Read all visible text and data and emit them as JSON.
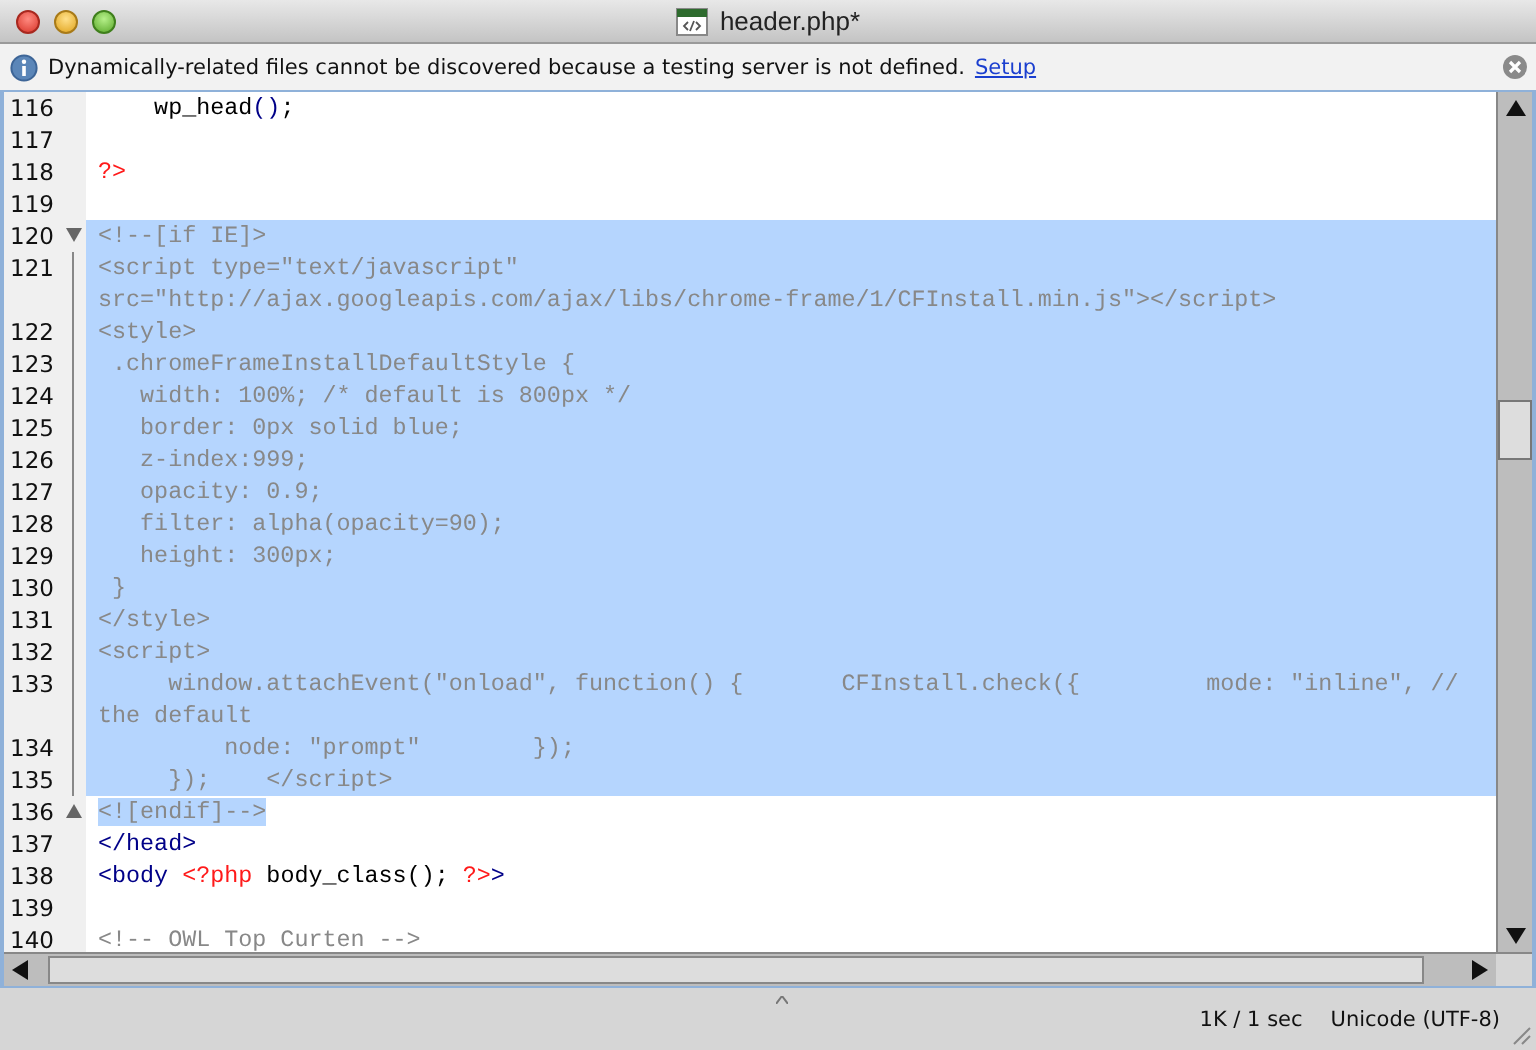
{
  "window": {
    "title": "header.php*"
  },
  "info_bar": {
    "message": "Dynamically-related files cannot be discovered because a testing server is not defined.",
    "link": "Setup"
  },
  "lines": [
    {
      "number": "116",
      "kind": "code",
      "selected": false,
      "segments": [
        {
          "kind": "plain",
          "text": "    wp_head"
        },
        {
          "kind": "tag",
          "text": "()"
        },
        {
          "kind": "plain",
          "text": ";"
        }
      ]
    },
    {
      "number": "117",
      "kind": "code",
      "selected": false
    },
    {
      "number": "118",
      "kind": "code",
      "selected": false,
      "segments": [
        {
          "kind": "php",
          "text": "?>"
        }
      ]
    },
    {
      "number": "119",
      "kind": "code",
      "selected": false
    },
    {
      "number": "120",
      "kind": "fold-start",
      "selected": true,
      "segments": [
        {
          "kind": "comment",
          "text": "<!--[if IE]>"
        }
      ]
    },
    {
      "number": "121",
      "kind": "code",
      "selected": true,
      "segments": [
        {
          "kind": "comment",
          "text": "<script type=\"text/javascript\""
        }
      ]
    },
    {
      "kind": "code",
      "selected": true,
      "segments": [
        {
          "kind": "comment",
          "text": "src=\"http://ajax.googleapis.com/ajax/libs/chrome-frame/1/CFInstall.min.js\"></script>"
        }
      ]
    },
    {
      "number": "122",
      "kind": "code",
      "selected": true,
      "segments": [
        {
          "kind": "comment",
          "text": "<style>"
        }
      ]
    },
    {
      "number": "123",
      "kind": "code",
      "selected": true,
      "segments": [
        {
          "kind": "comment",
          "text": " .chromeFrameInstallDefaultStyle {"
        }
      ]
    },
    {
      "number": "124",
      "kind": "code",
      "selected": true,
      "segments": [
        {
          "kind": "comment",
          "text": "   width: 100%; /* default is 800px */"
        }
      ]
    },
    {
      "number": "125",
      "kind": "code",
      "selected": true,
      "segments": [
        {
          "kind": "comment",
          "text": "   border: 0px solid blue;"
        }
      ]
    },
    {
      "number": "126",
      "kind": "code",
      "selected": true,
      "segments": [
        {
          "kind": "comment",
          "text": "   z-index:999;"
        }
      ]
    },
    {
      "number": "127",
      "kind": "code",
      "selected": true,
      "segments": [
        {
          "kind": "comment",
          "text": "   opacity: 0.9;"
        }
      ]
    },
    {
      "number": "128",
      "kind": "code",
      "selected": true,
      "segments": [
        {
          "kind": "comment",
          "text": "   filter: alpha(opacity=90);"
        }
      ]
    },
    {
      "number": "129",
      "kind": "code",
      "selected": true,
      "segments": [
        {
          "kind": "comment",
          "text": "   height: 300px;"
        }
      ]
    },
    {
      "number": "130",
      "kind": "code",
      "selected": true,
      "segments": [
        {
          "kind": "comment",
          "text": " }"
        }
      ]
    },
    {
      "number": "131",
      "kind": "code",
      "selected": true,
      "segments": [
        {
          "kind": "comment",
          "text": "</style>"
        }
      ]
    },
    {
      "number": "132",
      "kind": "code",
      "selected": true,
      "segments": [
        {
          "kind": "comment",
          "text": "<script>"
        }
      ]
    },
    {
      "number": "133",
      "kind": "code",
      "selected": true,
      "segments": [
        {
          "kind": "comment",
          "text": "     window.attachEvent(\"onload\", function() {       CFInstall.check({         mode: \"inline\", //"
        }
      ]
    },
    {
      "kind": "code",
      "selected": true,
      "segments": [
        {
          "kind": "comment",
          "text": "the default"
        }
      ]
    },
    {
      "number": "134",
      "kind": "code",
      "selected": true,
      "segments": [
        {
          "kind": "comment",
          "text": "         node: \"prompt\"        });"
        }
      ]
    },
    {
      "number": "135",
      "kind": "code",
      "selected": true,
      "segments": [
        {
          "kind": "comment",
          "text": "     });    </script>"
        }
      ]
    },
    {
      "number": "136",
      "kind": "fold-end",
      "selected": false,
      "segments": [
        {
          "kind": "comment",
          "text": "<![endif]-->",
          "selected": true
        }
      ]
    },
    {
      "number": "137",
      "kind": "code",
      "selected": false,
      "segments": [
        {
          "kind": "tag",
          "text": "</head>"
        }
      ]
    },
    {
      "number": "138",
      "kind": "code",
      "selected": false,
      "segments": [
        {
          "kind": "tag",
          "text": "<body "
        },
        {
          "kind": "php",
          "text": "<?php"
        },
        {
          "kind": "plain",
          "text": " body_class(); "
        },
        {
          "kind": "php",
          "text": "?>"
        },
        {
          "kind": "tag",
          "text": ">"
        }
      ]
    },
    {
      "number": "139",
      "kind": "code",
      "selected": false
    },
    {
      "number": "140",
      "kind": "code",
      "selected": false,
      "segments": [
        {
          "kind": "comment",
          "text": "<!-- OWL Top Curten -->"
        }
      ]
    }
  ],
  "status_bar": {
    "download": "1K / 1 sec",
    "encoding": "Unicode (UTF-8)"
  }
}
